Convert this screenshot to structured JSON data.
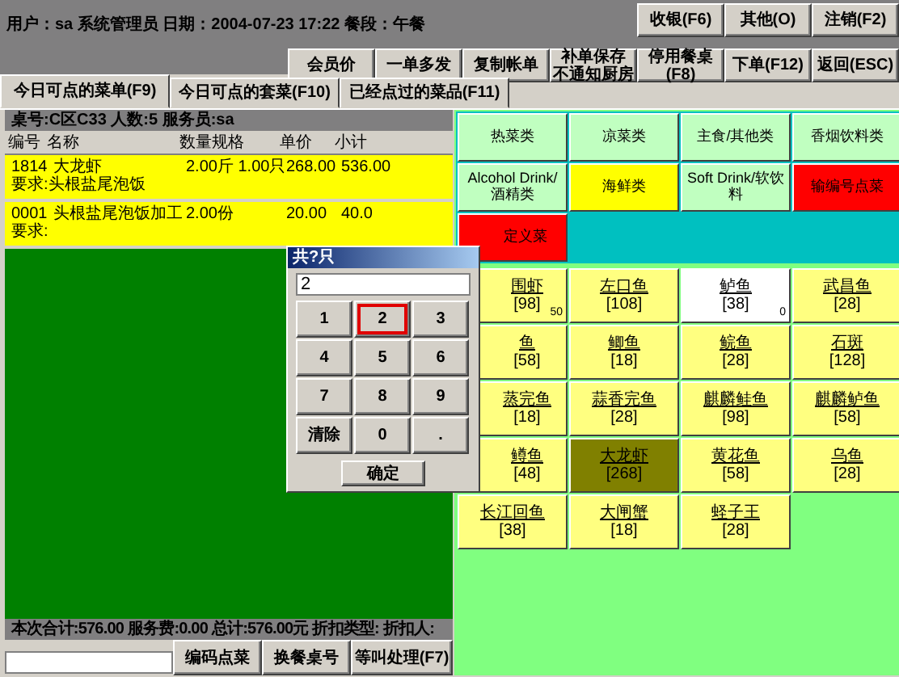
{
  "header": {
    "user_info": "用户：sa 系统管理员 日期：2004-07-23 17:22 餐段：午餐"
  },
  "toolbar_row_1": [
    {
      "lines": [
        "收银(F6)"
      ]
    },
    {
      "lines": [
        "其他(O)"
      ]
    },
    {
      "lines": [
        "注销(F2)"
      ]
    }
  ],
  "toolbar_row_2": [
    {
      "lines": [
        "会员价"
      ]
    },
    {
      "lines": [
        "一单多发"
      ]
    },
    {
      "lines": [
        "复制帐单"
      ]
    },
    {
      "lines": [
        "补单保存",
        "不通知厨房"
      ]
    },
    {
      "lines": [
        "停用餐桌",
        "(F8)"
      ]
    },
    {
      "lines": [
        "下单(F12)"
      ]
    },
    {
      "lines": [
        "返回(ESC)"
      ]
    }
  ],
  "tabs": [
    {
      "label": "今日可点的菜单(F9)",
      "selected": true
    },
    {
      "label": "今日可点的套菜(F10)",
      "selected": false
    },
    {
      "label": "已经点过的菜品(F11)",
      "selected": false
    }
  ],
  "order": {
    "table_info": "桌号:C区C33 人数:5 服务员:sa",
    "columns": [
      "编号",
      "名称",
      "数量规格",
      "单价",
      "小计"
    ],
    "rows": [
      {
        "number": "1814",
        "name": "大龙虾",
        "quantity": "2.00斤 1.00只",
        "unit_price": "268.00",
        "subtotal": "536.00",
        "request": "要求:头根盐尾泡饭"
      },
      {
        "number": "0001",
        "name": "头根盐尾泡饭加工",
        "quantity": "2.00份",
        "unit_price": "20.00",
        "subtotal": "40.0",
        "request": "要求:"
      }
    ],
    "totals": "本次合计:576.00 服务费:0.00 总计:576.00元 折扣类型: 折扣人:",
    "buttons": [
      "编码点菜",
      "换餐桌号",
      "等叫处理(F7)"
    ]
  },
  "categories": [
    {
      "label": "热菜类",
      "color": "#c0ffc0"
    },
    {
      "label": "凉菜类",
      "color": "#c0ffc0"
    },
    {
      "label": "主食/其他类",
      "color": "#c0ffc0"
    },
    {
      "label": "香烟饮料类",
      "color": "#c0ffc0"
    },
    {
      "label": "Alcohol Drink/酒精类",
      "color": "#c0ffc0"
    },
    {
      "label": "海鲜类",
      "color": "#ffff00"
    },
    {
      "label": "Soft Drink/软饮料",
      "color": "#c0ffc0"
    },
    {
      "label": "输编号点菜",
      "color": "#ff0000"
    },
    {
      "label": "定义菜",
      "color": "#ff0000"
    }
  ],
  "dishes": [
    {
      "name": "围虾",
      "price": "[98]",
      "count": "50",
      "color": "#ffff80"
    },
    {
      "name": "左口鱼",
      "price": "[108]",
      "color": "#ffff80"
    },
    {
      "name": "鲈鱼",
      "price": "[38]",
      "count": "0",
      "color": "#ffffff"
    },
    {
      "name": "武昌鱼",
      "price": "[28]",
      "color": "#ffff80"
    },
    {
      "name": "鱼",
      "price": "[58]",
      "color": "#ffff80"
    },
    {
      "name": "鲫鱼",
      "price": "[18]",
      "color": "#ffff80"
    },
    {
      "name": "鲩鱼",
      "price": "[28]",
      "color": "#ffff80"
    },
    {
      "name": "石斑",
      "price": "[128]",
      "color": "#ffff80"
    },
    {
      "name": "蒸完鱼",
      "price": "[18]",
      "color": "#ffff80"
    },
    {
      "name": "蒜香完鱼",
      "price": "[28]",
      "color": "#ffff80"
    },
    {
      "name": "麒麟鲑鱼",
      "price": "[98]",
      "color": "#ffff80"
    },
    {
      "name": "麒麟鲈鱼",
      "price": "[58]",
      "color": "#ffff80"
    },
    {
      "name": "鳟鱼",
      "price": "[48]",
      "color": "#ffff80"
    },
    {
      "name": "大龙虾",
      "price": "[268]",
      "color": "#808000"
    },
    {
      "name": "黄花鱼",
      "price": "[58]",
      "color": "#ffff80"
    },
    {
      "name": "乌鱼",
      "price": "[28]",
      "color": "#ffff80"
    },
    {
      "name": "长江回鱼",
      "price": "[38]",
      "color": "#ffff80"
    },
    {
      "name": "大闸蟹",
      "price": "[18]",
      "color": "#ffff80"
    },
    {
      "name": "蛏子王",
      "price": "[28]",
      "color": "#ffff80"
    }
  ],
  "dialog": {
    "title": "共?只",
    "value": "2",
    "keys": [
      {
        "label": "1",
        "focused": false
      },
      {
        "label": "2",
        "focused": true
      },
      {
        "label": "3",
        "focused": false
      },
      {
        "label": "4",
        "focused": false
      },
      {
        "label": "5",
        "focused": false
      },
      {
        "label": "6",
        "focused": false
      },
      {
        "label": "7",
        "focused": false
      },
      {
        "label": "8",
        "focused": false
      },
      {
        "label": "9",
        "focused": false
      },
      {
        "label": "清除",
        "focused": false
      },
      {
        "label": "0",
        "focused": false
      },
      {
        "label": ".",
        "focused": false
      }
    ],
    "confirm": "确定"
  }
}
